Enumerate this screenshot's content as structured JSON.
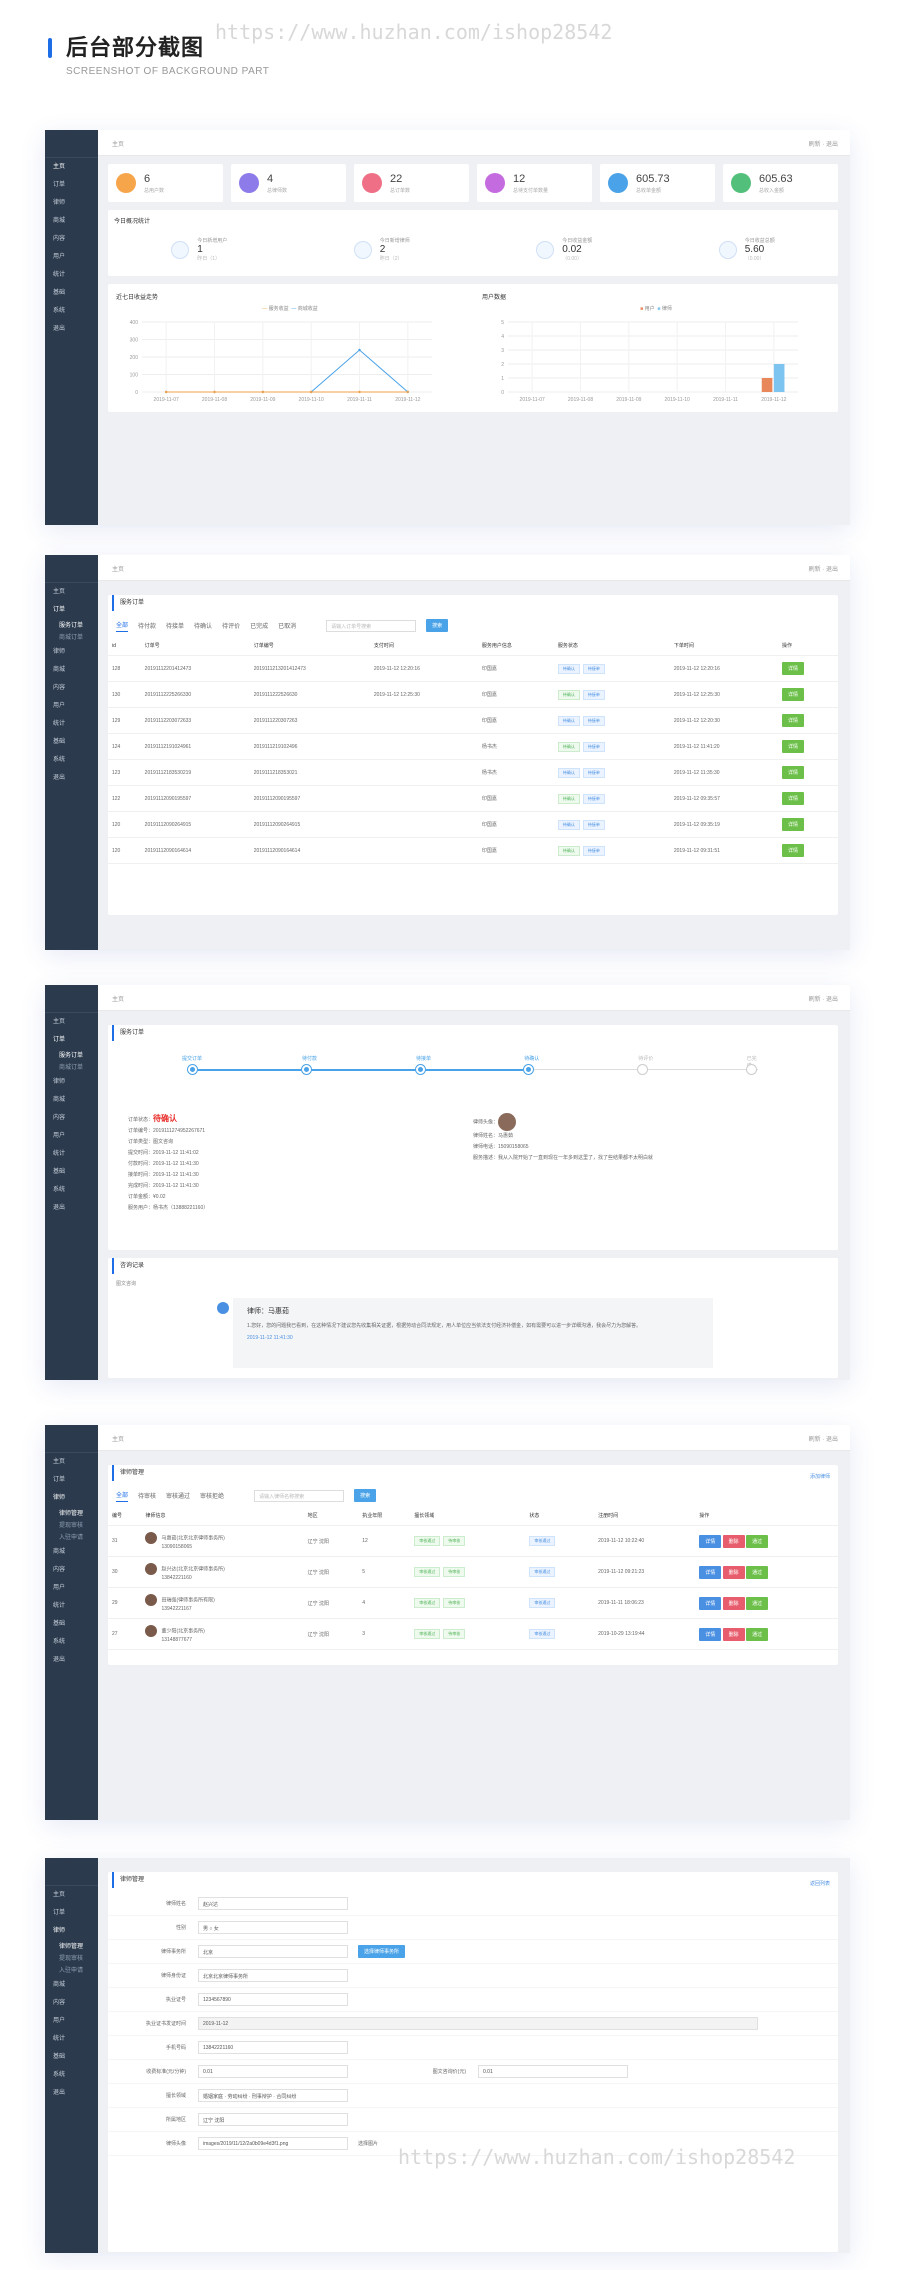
{
  "header": {
    "title": "后台部分截图",
    "subtitle": "SCREENSHOT OF BACKGROUND PART"
  },
  "watermark": "https://www.huzhan.com/ishop28542",
  "topbar": {
    "home": "主页",
    "refresh": "刷新",
    "logout": "退出"
  },
  "sidebar": [
    "主页",
    "订单",
    "律师",
    "商城",
    "内容",
    "用户",
    "统计",
    "基础",
    "系统",
    "退出"
  ],
  "sidebar_subs": {
    "order": [
      "服务订单",
      "商城订单"
    ],
    "lawyer": [
      "律师管理",
      "提现审核",
      "入驻申请"
    ]
  },
  "panel1": {
    "stats": [
      {
        "value": "6",
        "label": "总用户数",
        "color": "#f7a54a"
      },
      {
        "value": "4",
        "label": "总律师数",
        "color": "#8c7be8"
      },
      {
        "value": "22",
        "label": "总订单数",
        "color": "#ee6f86"
      },
      {
        "value": "12",
        "label": "总待支付单数量",
        "color": "#c56be0"
      },
      {
        "value": "605.73",
        "label": "总收单金额",
        "color": "#4aa3e8"
      },
      {
        "value": "605.63",
        "label": "总收入金额",
        "color": "#52c07a"
      }
    ],
    "today_title": "今日概况统计",
    "today": [
      {
        "label": "今日新增用户",
        "value": "1",
        "sub": "昨日（1）"
      },
      {
        "label": "今日新增律师",
        "value": "2",
        "sub": "昨日（2）"
      },
      {
        "label": "今日收益金额",
        "value": "0.02",
        "sub": "（0.00）"
      },
      {
        "label": "今日收益总额",
        "value": "5.60",
        "sub": "（0.00）"
      }
    ],
    "chart1_title": "近七日收益走势",
    "chart2_title": "用户数据",
    "chart_dates": [
      "2019-11-07",
      "2019-11-08",
      "2019-11-09",
      "2019-11-10",
      "2019-11-11",
      "2019-11-12"
    ]
  },
  "chart_data": [
    {
      "type": "line",
      "title": "近七日收益走势",
      "legend": [
        "服务收益",
        "商城收益"
      ],
      "categories": [
        "2019-11-07",
        "2019-11-08",
        "2019-11-09",
        "2019-11-10",
        "2019-11-11",
        "2019-11-12"
      ],
      "series": [
        {
          "name": "服务收益",
          "values": [
            0,
            0,
            0,
            0,
            240,
            0
          ]
        },
        {
          "name": "商城收益",
          "values": [
            0,
            0,
            0,
            0,
            0,
            0
          ]
        }
      ],
      "ylim": [
        0,
        400
      ],
      "yticks": [
        "400",
        "300",
        "200",
        "100",
        "0"
      ]
    },
    {
      "type": "bar",
      "title": "用户数据",
      "legend": [
        "用户",
        "律师"
      ],
      "categories": [
        "2019-11-07",
        "2019-11-08",
        "2019-11-09",
        "2019-11-10",
        "2019-11-11",
        "2019-11-12"
      ],
      "series": [
        {
          "name": "用户",
          "values": [
            0,
            0,
            0,
            0,
            0,
            1
          ]
        },
        {
          "name": "律师",
          "values": [
            0,
            0,
            0,
            0,
            0,
            2
          ]
        }
      ],
      "ylim": [
        0,
        5
      ],
      "yticks": [
        "5",
        "4",
        "3",
        "2",
        "1",
        "0"
      ]
    }
  ],
  "panel2": {
    "title": "服务订单",
    "tabs": [
      "全部",
      "待付款",
      "待接单",
      "待确认",
      "待评价",
      "已完成",
      "已取消"
    ],
    "search_placeholder": "请输入订单号搜索",
    "search_btn": "搜索",
    "columns": [
      "id",
      "订单号",
      "订单编号",
      "支付时间",
      "服务用户信息",
      "服务状态",
      "下单时间",
      "操作"
    ],
    "rows": [
      [
        "128",
        "20191112201412473",
        "2019111213201412473",
        "2019-11-12 12:20:16",
        "印国嘉",
        "2019-11-12 12:20:16"
      ],
      [
        "130",
        "20191112225266330",
        "2019111222526630",
        "2019-11-12 12:25:30",
        "印国嘉",
        "2019-11-12 12:25:30"
      ],
      [
        "129",
        "20191112203072633",
        "2019111220307263",
        "",
        "印国嘉",
        "2019-11-12 12:20:30"
      ],
      [
        "124",
        "20191112191024961",
        "2019111219102496",
        "",
        "杨书杰",
        "2019-11-12 11:41:20"
      ],
      [
        "123",
        "20191112183530219",
        "2019111218353021",
        "",
        "杨书杰",
        "2019-11-12 11:35:30"
      ],
      [
        "122",
        "20191112090195597",
        "20191112090195597",
        "",
        "印国嘉",
        "2019-11-12 09:35:57"
      ],
      [
        "120",
        "20191112090264915",
        "20191112090264915",
        "",
        "印国嘉",
        "2019-11-12 09:35:19"
      ],
      [
        "120",
        "20191112090164614",
        "20191112090164614",
        "",
        "印国嘉",
        "2019-11-12 09:31:51"
      ]
    ],
    "action": "详情"
  },
  "panel3": {
    "title": "服务订单",
    "steps": [
      "提交订单",
      "待付款",
      "待接单",
      "待确认",
      "待评价",
      "已完成"
    ],
    "status_label": "订单状态：",
    "status": "待确认",
    "info": [
      "订单编号：2019111274952267671",
      "订单类型：图文咨询",
      "提交时间：2019-11-12 11:41:02",
      "付款时间：2019-11-12 11:41:30",
      "接单时间：2019-11-12 11:41:30",
      "完成时间：2019-11-12 11:41:30",
      "订单金额：¥0.02",
      "服务用户：杨书杰（13888221160）"
    ],
    "user_info": [
      "律师头像：",
      "律师姓名：马惠茹",
      "律师电话：15090158065",
      "服务描述：我从入院开始了一直到现在一年多到这里了，找了些结果都不太明白就"
    ],
    "consult_title": "咨询记录",
    "consult_sub": "图文咨询",
    "lawyer_name": "律师：马惠茹",
    "lawyer_msg": "1.您好，您的问题我已看到，在这种情况下建议您先收集相关证据，根据劳动合同法规定，用人单位应当依法支付经济补偿金，如有需要可以进一步详细沟通，我会尽力为您解答。",
    "lawyer_time": "2019-11-12 11:41:30"
  },
  "panel4": {
    "title": "律师管理",
    "add": "添加律师",
    "tabs": [
      "全部",
      "待审核",
      "审核通过",
      "审核拒绝"
    ],
    "search_placeholder": "请输入律师名称搜索",
    "search_btn": "搜索",
    "columns": [
      "编号",
      "律师信息",
      "地区",
      "执业年限",
      "擅长领域",
      "状态",
      "注册时间",
      "操作"
    ],
    "rows": [
      [
        "31",
        "马惠茹(北京北京律师事务所)",
        "13090158065",
        "辽宁 沈阳",
        "12",
        "2019-11-12 10:22:40"
      ],
      [
        "30",
        "赵兴达(北京北京律师事务所)",
        "13842221160",
        "辽宁 沈阳",
        "5",
        "2019-11-12 09:21:23"
      ],
      [
        "29",
        "田瑞强(律师事务所有限)",
        "13942221167",
        "辽宁 沈阳",
        "4",
        "2019-11-11 18:06:23"
      ],
      [
        "27",
        "董少阳(北京事务所)",
        "13148877677",
        "辽宁 沈阳",
        "3",
        "2019-10-29 13:19:44"
      ]
    ],
    "btns": [
      "详情",
      "删除",
      "通过"
    ]
  },
  "panel5": {
    "title": "律师管理",
    "back": "返回列表",
    "fields": [
      [
        "律师姓名",
        "赵兴达"
      ],
      [
        "性别",
        "男 ○ 女"
      ],
      [
        "律师事务所",
        "北京"
      ],
      [
        "律师身份证",
        "北京北京律师事务所"
      ],
      [
        "执业证号",
        "1234567890"
      ],
      [
        "执业证书发证时间",
        "2019-11-12"
      ],
      [
        "手机号码",
        "13842221160"
      ],
      [
        "收费标准(元/分钟)",
        "0.01"
      ],
      [
        "擅长领域",
        "婚姻家庭 · 劳动纠纷 · 刑事辩护 · 合同纠纷"
      ],
      [
        "所属地区",
        "辽宁 沈阳"
      ],
      [
        "律师头像",
        "images/2019/11/12/2a0b09e4d3f1.png"
      ]
    ],
    "right_label": "图文咨询价(元)",
    "right_value": "0.01",
    "select_btn": "选择律师事务所",
    "upload": "选择图片"
  }
}
